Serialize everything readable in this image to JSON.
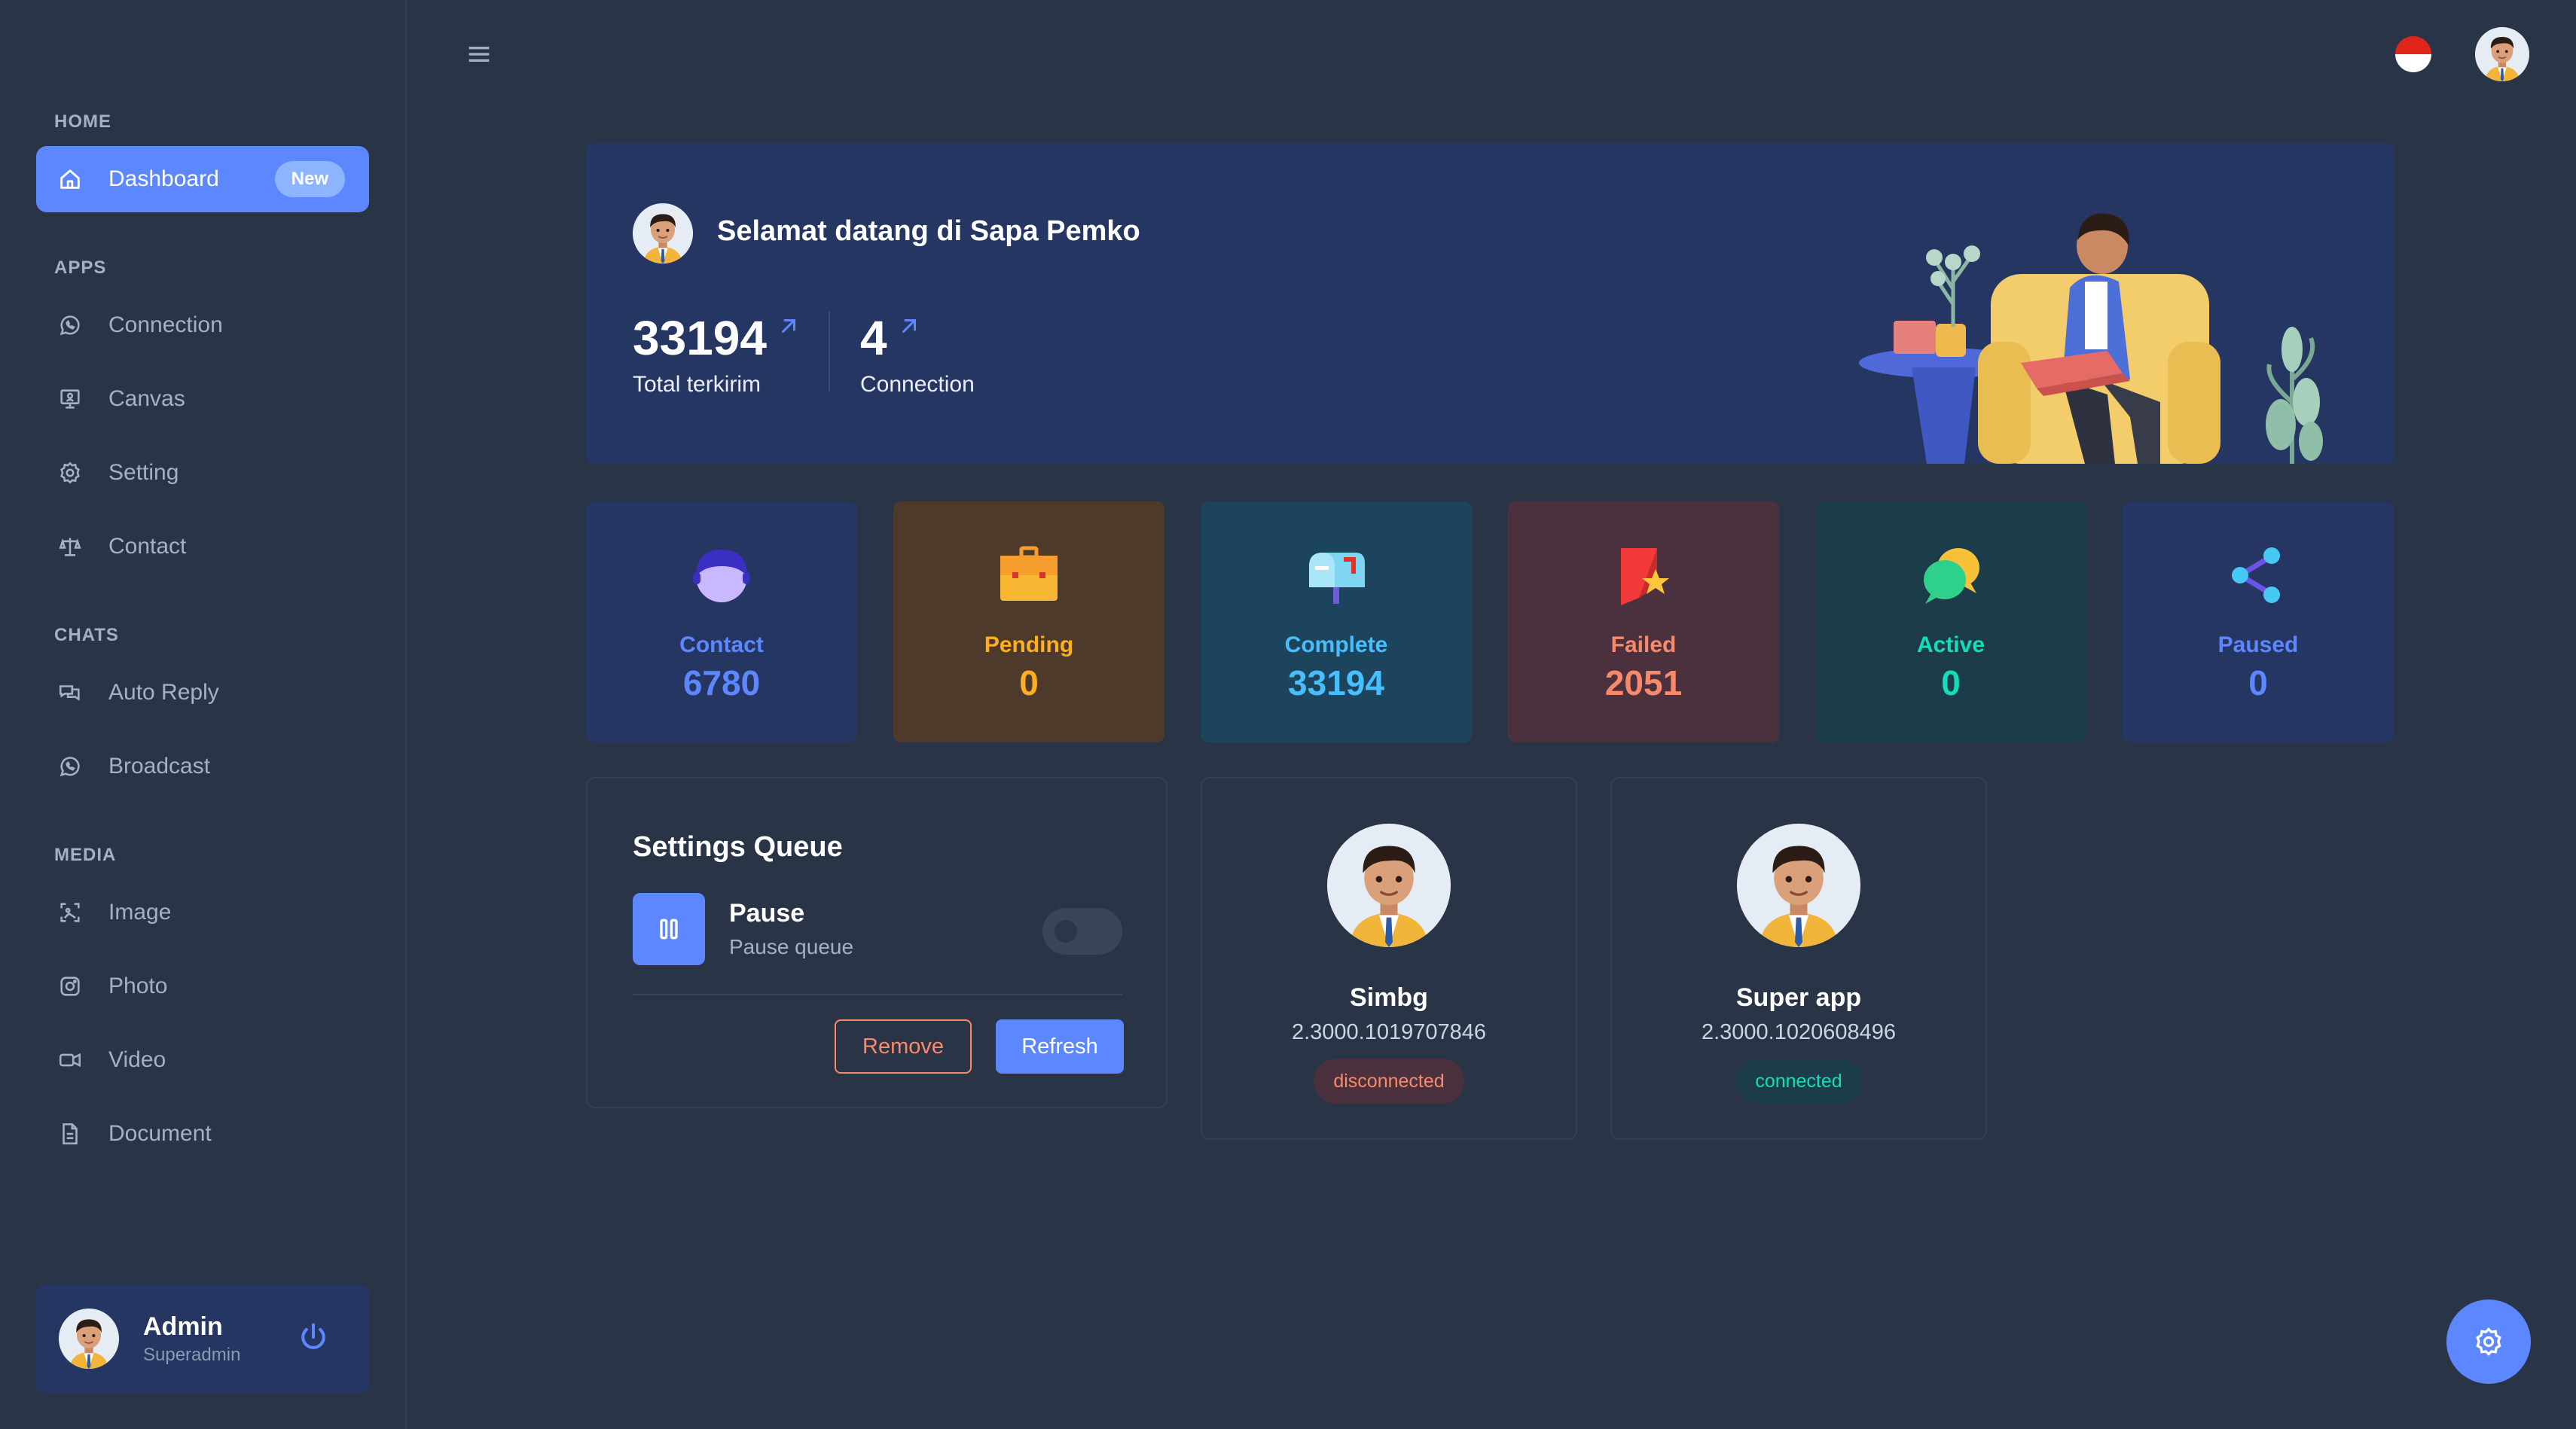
{
  "sidebar": {
    "sections": [
      {
        "caption": "HOME"
      },
      {
        "caption": "APPS"
      },
      {
        "caption": "CHATS"
      },
      {
        "caption": "MEDIA"
      }
    ],
    "items": [
      {
        "label": "Dashboard",
        "icon": "home-icon",
        "badge": "New",
        "active": true
      },
      {
        "label": "Connection",
        "icon": "whatsapp-icon"
      },
      {
        "label": "Canvas",
        "icon": "presentation-icon"
      },
      {
        "label": "Setting",
        "icon": "gear-icon"
      },
      {
        "label": "Contact",
        "icon": "scale-icon"
      },
      {
        "label": "Auto Reply",
        "icon": "chat-bubbles-icon"
      },
      {
        "label": "Broadcast",
        "icon": "whatsapp-icon"
      },
      {
        "label": "Image",
        "icon": "image-scan-icon"
      },
      {
        "label": "Photo",
        "icon": "instagram-icon"
      },
      {
        "label": "Video",
        "icon": "video-icon"
      },
      {
        "label": "Document",
        "icon": "document-icon"
      }
    ],
    "profile": {
      "name": "Admin",
      "role": "Superadmin"
    }
  },
  "header": {
    "flag": "indonesia-flag",
    "menu_icon": "hamburger-icon"
  },
  "banner": {
    "title": "Selamat datang di Sapa Pemko",
    "stats": [
      {
        "value": "33194",
        "label": "Total terkirim"
      },
      {
        "value": "4",
        "label": "Connection"
      }
    ]
  },
  "stat_cards": [
    {
      "label": "Contact",
      "value": "6780",
      "bg": "#253662",
      "color": "#5d87ff",
      "icon": "user-head-icon"
    },
    {
      "label": "Pending",
      "value": "0",
      "bg": "#4d3a2a",
      "color": "#ffae1f",
      "icon": "briefcase-icon"
    },
    {
      "label": "Complete",
      "value": "33194",
      "bg": "#1c455d",
      "color": "#49beff",
      "icon": "mailbox-icon"
    },
    {
      "label": "Failed",
      "value": "2051",
      "bg": "#4b313d",
      "color": "#fa896b",
      "icon": "favorite-flag-icon"
    },
    {
      "label": "Active",
      "value": "0",
      "bg": "#1b3c48",
      "color": "#13deb9",
      "icon": "speech-bubble-icon"
    },
    {
      "label": "Paused",
      "value": "0",
      "bg": "#253662",
      "color": "#5d87ff",
      "icon": "share-nodes-icon"
    }
  ],
  "queue": {
    "title": "Settings Queue",
    "toggle_label": "Pause",
    "toggle_sub": "Pause queue",
    "remove_label": "Remove",
    "refresh_label": "Refresh"
  },
  "connections": [
    {
      "name": "Simbg",
      "number": "2.3000.1019707846",
      "status": "disconnected"
    },
    {
      "name": "Super app",
      "number": "2.3000.1020608496",
      "status": "connected"
    }
  ],
  "colors": {
    "primary": "#5d87ff",
    "bg": "#2a3447",
    "error": "#fa896b",
    "success": "#13deb9"
  }
}
